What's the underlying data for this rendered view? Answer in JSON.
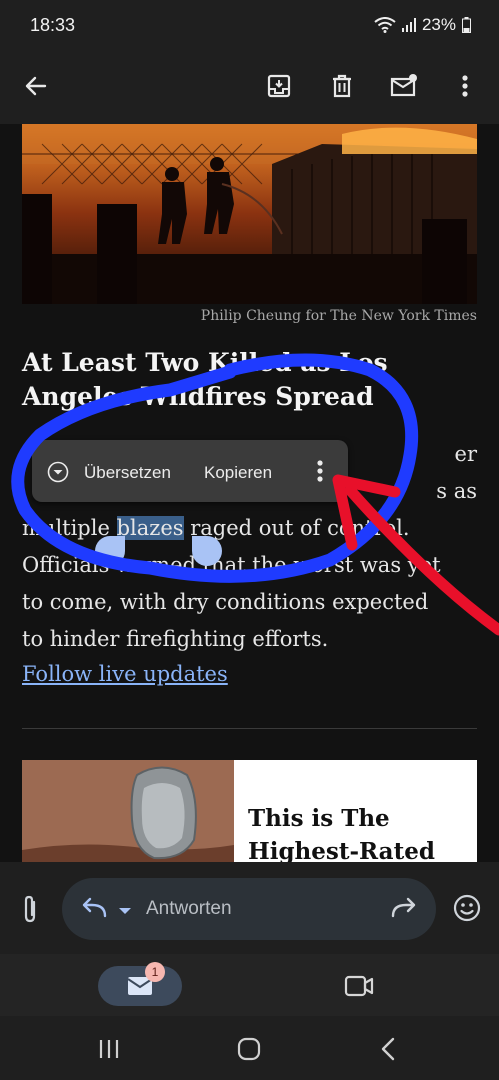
{
  "status_bar": {
    "time": "18:33",
    "battery": "23%"
  },
  "toolbar": {
    "back_icon": "arrow-left-icon",
    "archive_icon": "archive-icon",
    "delete_icon": "trash-icon",
    "mark_unread_icon": "mail-unread-icon",
    "more_icon": "more-vertical-icon"
  },
  "article": {
    "photo_credit": "Philip Cheung for The New York Times",
    "headline_line1": "At Least Two Killed as Los",
    "headline_line2": "Angeles Wildfires Spread",
    "body_line1_end": "er",
    "body_line2_end": "s as",
    "body_line3_pre": "multiple ",
    "body_line3_sel": "blazes",
    "body_line3_post": " raged out of control.",
    "body_line4": "Officials warned that the worst was yet",
    "body_line5": "to come, with dry conditions expected",
    "body_line6": "to hinder firefighting efforts.",
    "link": "Follow live updates"
  },
  "promo": {
    "title_line1": "This is The",
    "title_line2": "Highest-Rated"
  },
  "context_menu": {
    "translate": "Übersetzen",
    "copy": "Kopieren"
  },
  "reply_bar": {
    "placeholder": "Antworten"
  },
  "bottom_nav": {
    "mail_badge": "1"
  },
  "colors": {
    "annotation_blue": "#1f3bff",
    "annotation_red": "#e8102a",
    "link": "#8ab4f8"
  }
}
